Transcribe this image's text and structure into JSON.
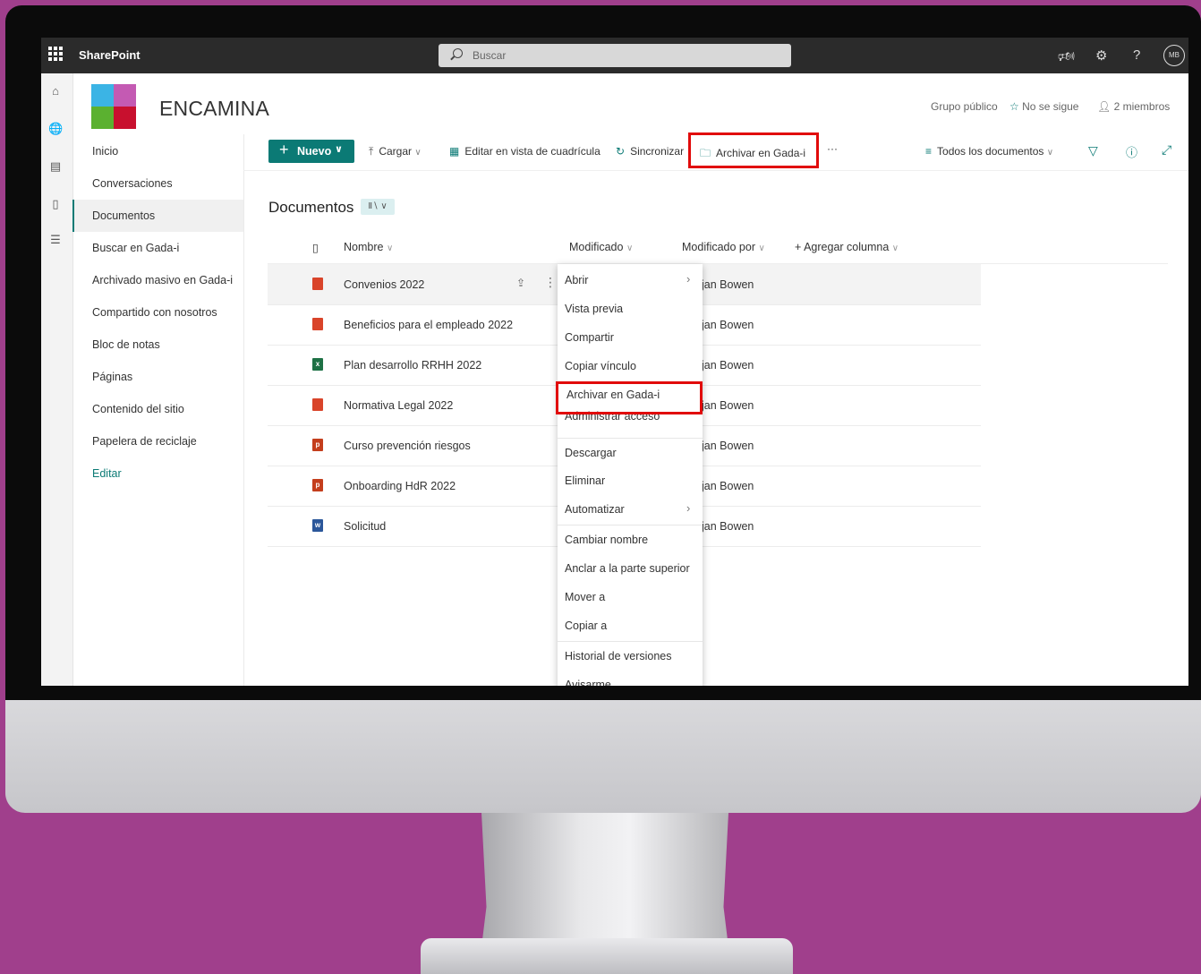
{
  "suitebar": {
    "app_name": "SharePoint",
    "search_placeholder": "Buscar",
    "avatar_initials": "MB"
  },
  "site": {
    "title": "ENCAMINA",
    "group_type": "Grupo público",
    "follow_label": "No se sigue",
    "members_label": "2 miembros",
    "logo_colors": [
      "#3bb4e5",
      "#c45ab3",
      "#5bb130",
      "#c8102e"
    ]
  },
  "leftnav": {
    "items": [
      {
        "label": "Inicio"
      },
      {
        "label": "Conversaciones"
      },
      {
        "label": "Documentos"
      },
      {
        "label": "Buscar en Gada-i"
      },
      {
        "label": "Archivado masivo en Gada-i"
      },
      {
        "label": "Compartido con nosotros"
      },
      {
        "label": "Bloc de notas"
      },
      {
        "label": "Páginas"
      },
      {
        "label": "Contenido del sitio"
      },
      {
        "label": "Papelera de reciclaje"
      },
      {
        "label": "Editar"
      }
    ],
    "active_index": 2
  },
  "commandbar": {
    "new_label": "Nuevo",
    "upload_label": "Cargar",
    "grid_edit_label": "Editar en vista de cuadrícula",
    "sync_label": "Sincronizar",
    "archive_label": "Archivar en Gada-i",
    "more_label": "···",
    "view_label": "Todos los documentos"
  },
  "library": {
    "title": "Documentos",
    "columns": {
      "name": "Nombre",
      "modified": "Modificado",
      "modified_by": "Modificado por",
      "add_column": "+ Agregar columna"
    },
    "rows": [
      {
        "name": "Convenios 2022",
        "modified_by": "jan Bowen",
        "type": "pdf"
      },
      {
        "name": "Beneficios para el empleado 2022",
        "modified_by": "jan Bowen",
        "type": "pdf"
      },
      {
        "name": "Plan desarrollo RRHH 2022",
        "modified_by": "jan Bowen",
        "type": "excel"
      },
      {
        "name": "Normativa Legal 2022",
        "modified_by": "jan Bowen",
        "type": "pdf"
      },
      {
        "name": "Curso prevención riesgos",
        "modified_by": "jan Bowen",
        "type": "powerpoint"
      },
      {
        "name": "Onboarding HdR 2022",
        "modified_by": "jan Bowen",
        "type": "powerpoint"
      },
      {
        "name": "Solicitud",
        "modified_by": "jan Bowen",
        "type": "word"
      }
    ]
  },
  "context_menu": {
    "items": [
      {
        "label": "Abrir"
      },
      {
        "label": "Vista previa"
      },
      {
        "label": "Compartir"
      },
      {
        "label": "Copiar vínculo"
      },
      {
        "label": "Archivar en Gada-i"
      },
      {
        "label": "Administrar acceso"
      },
      {
        "label": "Descargar"
      },
      {
        "label": "Eliminar"
      },
      {
        "label": "Automatizar"
      },
      {
        "label": "Cambiar nombre"
      },
      {
        "label": "Anclar a la parte superior"
      },
      {
        "label": "Mover a"
      },
      {
        "label": "Copiar a"
      },
      {
        "label": "Historial de versiones"
      },
      {
        "label": "Avisarme"
      }
    ]
  },
  "colors": {
    "accent": "#0b7a75",
    "highlight": "#e10b0b",
    "background": "#a03f8c",
    "pdf": "#d9442a",
    "excel": "#1e7145",
    "powerpoint": "#c43e1c",
    "word": "#2b579a"
  }
}
